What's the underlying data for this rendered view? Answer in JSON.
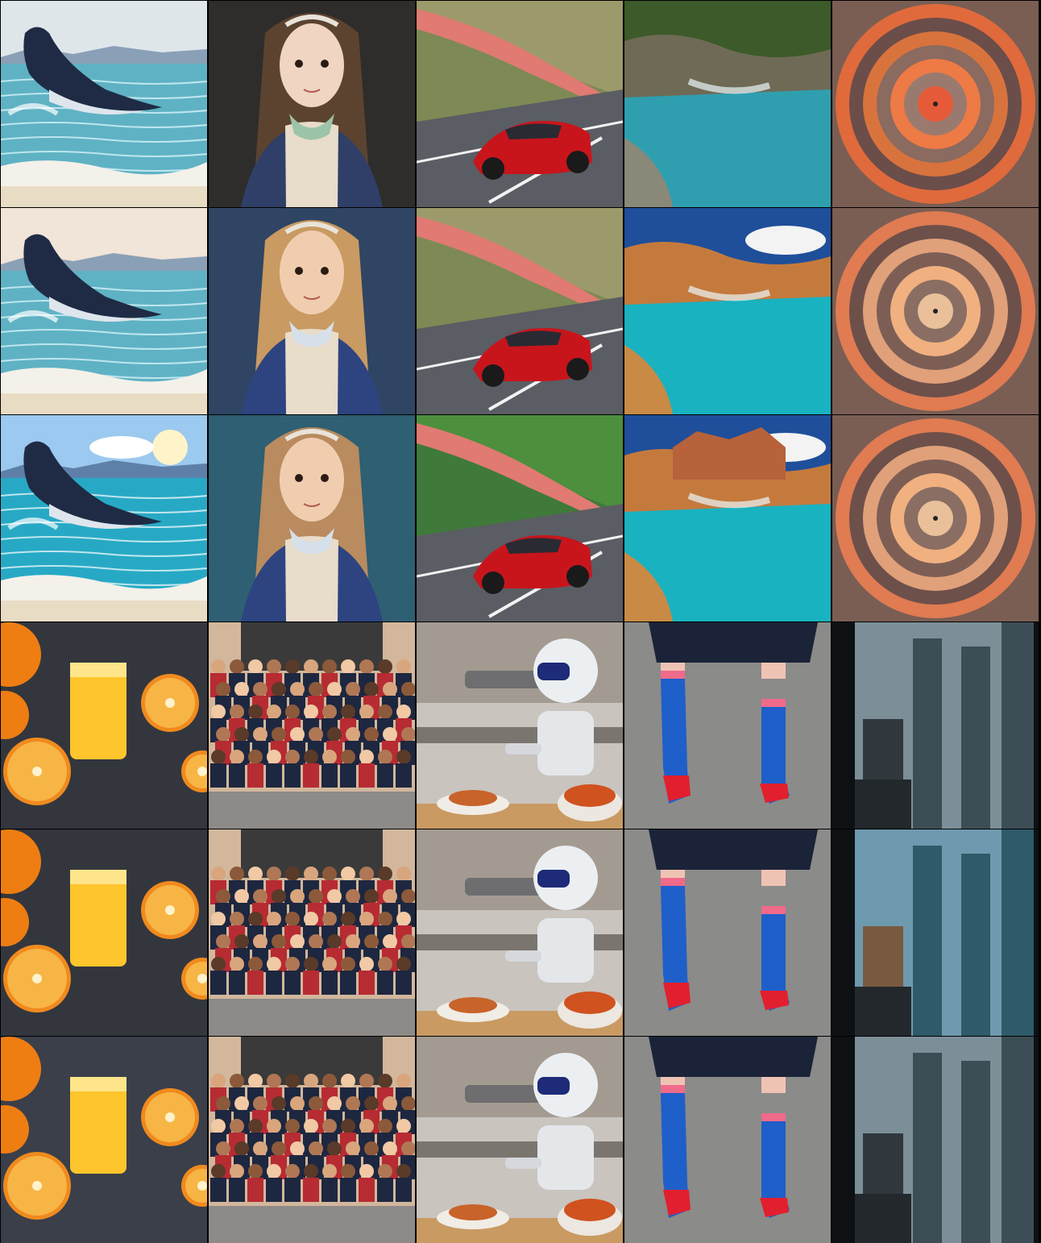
{
  "grid": {
    "rows": 6,
    "columns": 5,
    "cells": [
      {
        "subject": "whale",
        "variant": 1
      },
      {
        "subject": "girl-portrait",
        "variant": 1
      },
      {
        "subject": "red-car",
        "variant": 1
      },
      {
        "subject": "river",
        "variant": 1
      },
      {
        "subject": "rings",
        "variant": 1
      },
      {
        "subject": "whale",
        "variant": 2
      },
      {
        "subject": "girl-portrait",
        "variant": 2
      },
      {
        "subject": "red-car",
        "variant": 2
      },
      {
        "subject": "river",
        "variant": 2
      },
      {
        "subject": "rings",
        "variant": 2
      },
      {
        "subject": "whale",
        "variant": 3
      },
      {
        "subject": "girl-portrait",
        "variant": 3
      },
      {
        "subject": "red-car",
        "variant": 3
      },
      {
        "subject": "river",
        "variant": 3
      },
      {
        "subject": "rings",
        "variant": 3
      },
      {
        "subject": "oranges",
        "variant": 1
      },
      {
        "subject": "group-photo",
        "variant": 1
      },
      {
        "subject": "robot-chef",
        "variant": 1
      },
      {
        "subject": "socks",
        "variant": 1
      },
      {
        "subject": "city-rain",
        "variant": 1
      },
      {
        "subject": "oranges",
        "variant": 2
      },
      {
        "subject": "group-photo",
        "variant": 2
      },
      {
        "subject": "robot-chef",
        "variant": 2
      },
      {
        "subject": "socks",
        "variant": 2
      },
      {
        "subject": "city-rain",
        "variant": 2
      },
      {
        "subject": "oranges",
        "variant": 3
      },
      {
        "subject": "group-photo",
        "variant": 3
      },
      {
        "subject": "robot-chef",
        "variant": 3
      },
      {
        "subject": "socks",
        "variant": 3
      },
      {
        "subject": "city-rain",
        "variant": 3
      }
    ]
  }
}
